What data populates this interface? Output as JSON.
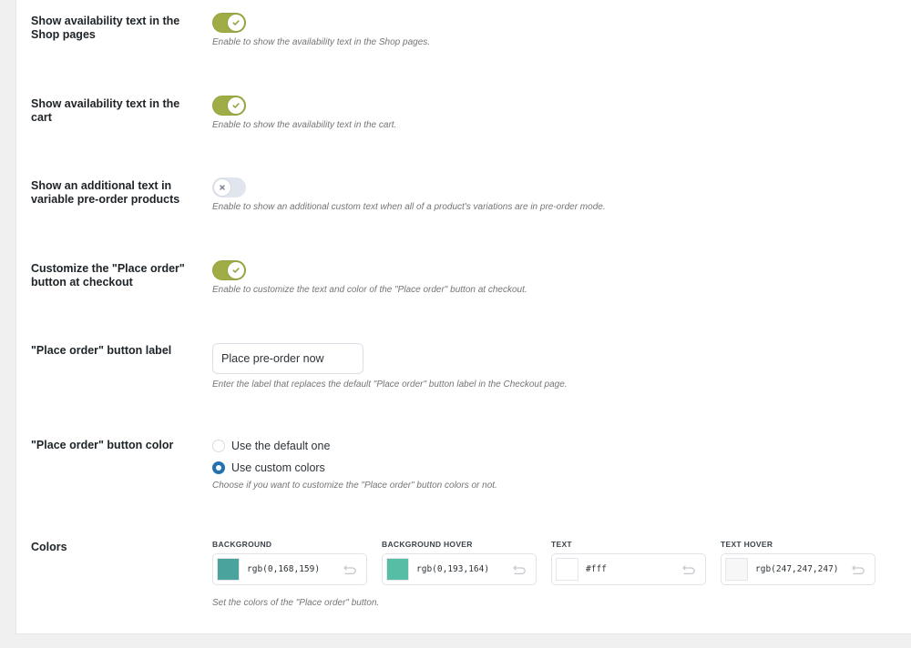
{
  "settings": {
    "shop_availability": {
      "label": "Show availability text in the Shop pages",
      "enabled": true,
      "description": "Enable to show the availability text in the Shop pages."
    },
    "cart_availability": {
      "label": "Show availability text in the cart",
      "enabled": true,
      "description": "Enable to show the availability text in the cart."
    },
    "variable_text": {
      "label": "Show an additional text in variable pre-order products",
      "enabled": false,
      "description": "Enable to show an additional custom text when all of a product's variations are in pre-order mode."
    },
    "customize_place_order": {
      "label": "Customize the \"Place order\" button at checkout",
      "enabled": true,
      "description": "Enable to customize the text and color of the \"Place order\" button at checkout."
    },
    "place_order_label": {
      "label": "\"Place order\" button label",
      "value": "Place pre-order now",
      "description": "Enter the label that replaces the default \"Place order\" button label in the Checkout page."
    },
    "place_order_color": {
      "label": "\"Place order\" button color",
      "options": [
        {
          "label": "Use the default one",
          "checked": false
        },
        {
          "label": "Use custom colors",
          "checked": true
        }
      ],
      "description": "Choose if you want to customize the \"Place order\" button colors or not."
    },
    "colors": {
      "label": "Colors",
      "items": [
        {
          "caption": "BACKGROUND",
          "value": "rgb(0,168,159)",
          "swatch": "#4aa39c"
        },
        {
          "caption": "BACKGROUND HOVER",
          "value": "rgb(0,193,164)",
          "swatch": "#56bea4"
        },
        {
          "caption": "TEXT",
          "value": "#fff",
          "swatch": "#ffffff"
        },
        {
          "caption": "TEXT HOVER",
          "value": "rgb(247,247,247)",
          "swatch": "#f7f7f7"
        }
      ],
      "description": "Set the colors of the \"Place order\" button."
    }
  },
  "icons": {
    "toggle_on": "check-icon",
    "toggle_off": "x-icon",
    "reset": "undo-icon"
  }
}
